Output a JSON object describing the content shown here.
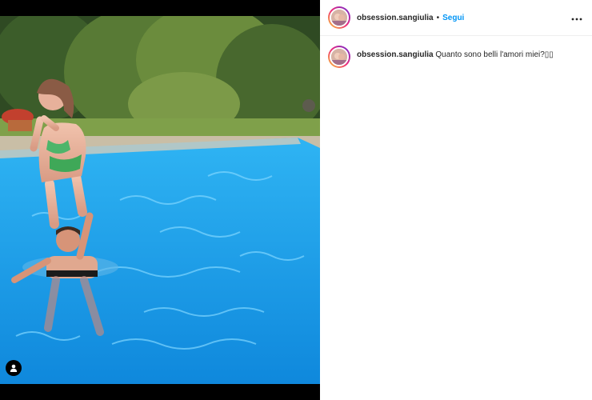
{
  "post": {
    "username": "obsession.sangiulia",
    "separator": "•",
    "follow_label": "Segui",
    "more_icon": "more-options-icon",
    "caption_text": "Quanto sono belli l'amori miei?▯▯"
  },
  "colors": {
    "accent": "#0095f6",
    "pool": "#1a9ee8",
    "text": "#262626"
  },
  "icons": {
    "tag": "user-tag-icon"
  }
}
